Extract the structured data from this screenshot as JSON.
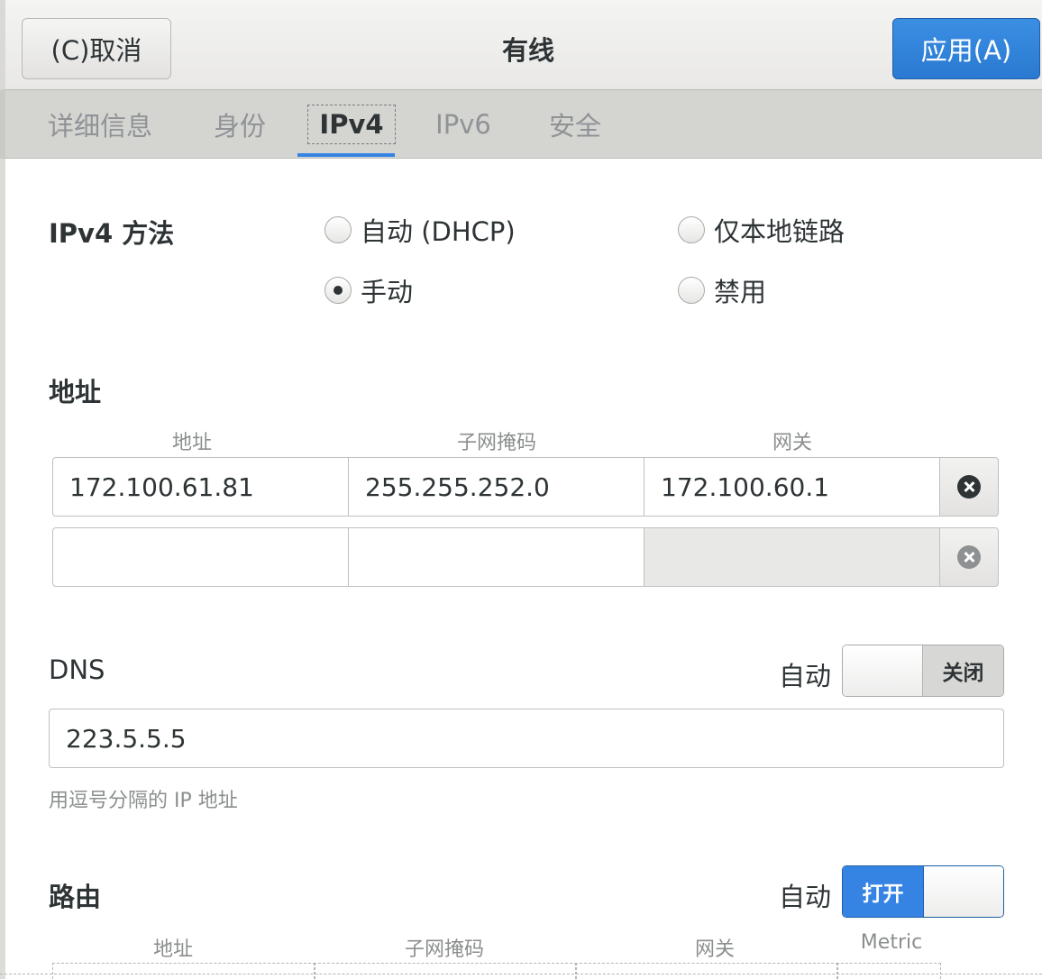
{
  "header": {
    "cancel_label": "(C)取消",
    "title": "有线",
    "apply_label": "应用(A)"
  },
  "tabs": [
    {
      "label": "详细信息",
      "active": false
    },
    {
      "label": "身份",
      "active": false
    },
    {
      "label": "IPv4",
      "active": true
    },
    {
      "label": "IPv6",
      "active": false
    },
    {
      "label": "安全",
      "active": false
    }
  ],
  "method": {
    "label": "IPv4 方法",
    "options": [
      {
        "label": "自动 (DHCP)",
        "checked": false
      },
      {
        "label": "仅本地链路",
        "checked": false
      },
      {
        "label": "手动",
        "checked": true
      },
      {
        "label": "禁用",
        "checked": false
      }
    ]
  },
  "addresses": {
    "section_label": "地址",
    "columns": [
      "地址",
      "子网掩码",
      "网关"
    ],
    "rows": [
      {
        "address": "172.100.61.81",
        "netmask": "255.255.252.0",
        "gateway": "172.100.60.1"
      },
      {
        "address": "",
        "netmask": "",
        "gateway": ""
      }
    ]
  },
  "dns": {
    "section_label": "DNS",
    "auto_label": "自动",
    "switch_state": "关闭",
    "value": "223.5.5.5",
    "hint": "用逗号分隔的 IP 地址"
  },
  "routes": {
    "section_label": "路由",
    "auto_label": "自动",
    "switch_state": "打开",
    "columns": [
      "地址",
      "子网掩码",
      "网关",
      "Metric"
    ]
  },
  "colors": {
    "accent": "#3584e4",
    "header_bg": "#efefed",
    "tab_bg": "#d4d4d1"
  }
}
